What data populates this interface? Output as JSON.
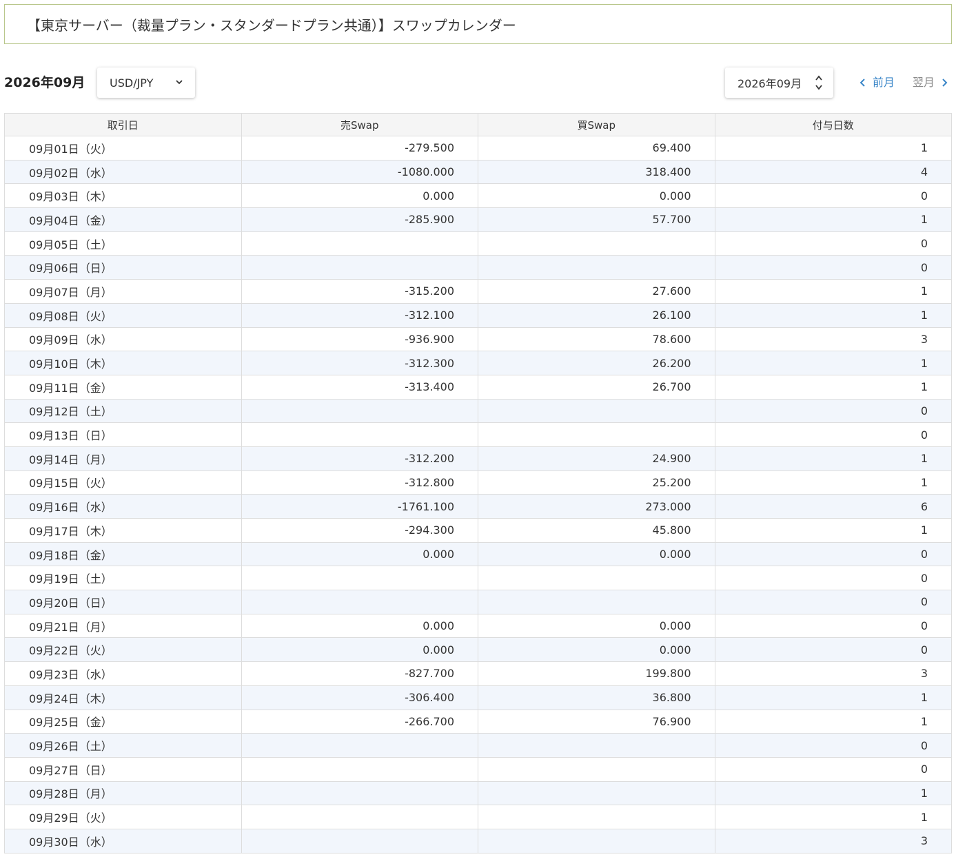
{
  "title": "【東京サーバー（裁量プラン・スタンダードプラン共通）】スワップカレンダー",
  "toolbar": {
    "month_label": "2026年09月",
    "pair_value": "USD/JPY",
    "month_input_value": "2026年09月",
    "prev_label": "前月",
    "next_label": "翌月"
  },
  "table": {
    "headers": [
      "取引日",
      "売Swap",
      "買Swap",
      "付与日数"
    ],
    "rows": [
      {
        "date": "09月01日（火）",
        "sell": "-279.500",
        "buy": "69.400",
        "days": "1"
      },
      {
        "date": "09月02日（水）",
        "sell": "-1080.000",
        "buy": "318.400",
        "days": "4"
      },
      {
        "date": "09月03日（木）",
        "sell": "0.000",
        "buy": "0.000",
        "days": "0"
      },
      {
        "date": "09月04日（金）",
        "sell": "-285.900",
        "buy": "57.700",
        "days": "1"
      },
      {
        "date": "09月05日（土）",
        "sell": "",
        "buy": "",
        "days": "0"
      },
      {
        "date": "09月06日（日）",
        "sell": "",
        "buy": "",
        "days": "0"
      },
      {
        "date": "09月07日（月）",
        "sell": "-315.200",
        "buy": "27.600",
        "days": "1"
      },
      {
        "date": "09月08日（火）",
        "sell": "-312.100",
        "buy": "26.100",
        "days": "1"
      },
      {
        "date": "09月09日（水）",
        "sell": "-936.900",
        "buy": "78.600",
        "days": "3"
      },
      {
        "date": "09月10日（木）",
        "sell": "-312.300",
        "buy": "26.200",
        "days": "1"
      },
      {
        "date": "09月11日（金）",
        "sell": "-313.400",
        "buy": "26.700",
        "days": "1"
      },
      {
        "date": "09月12日（土）",
        "sell": "",
        "buy": "",
        "days": "0"
      },
      {
        "date": "09月13日（日）",
        "sell": "",
        "buy": "",
        "days": "0"
      },
      {
        "date": "09月14日（月）",
        "sell": "-312.200",
        "buy": "24.900",
        "days": "1"
      },
      {
        "date": "09月15日（火）",
        "sell": "-312.800",
        "buy": "25.200",
        "days": "1"
      },
      {
        "date": "09月16日（水）",
        "sell": "-1761.100",
        "buy": "273.000",
        "days": "6"
      },
      {
        "date": "09月17日（木）",
        "sell": "-294.300",
        "buy": "45.800",
        "days": "1"
      },
      {
        "date": "09月18日（金）",
        "sell": "0.000",
        "buy": "0.000",
        "days": "0"
      },
      {
        "date": "09月19日（土）",
        "sell": "",
        "buy": "",
        "days": "0"
      },
      {
        "date": "09月20日（日）",
        "sell": "",
        "buy": "",
        "days": "0"
      },
      {
        "date": "09月21日（月）",
        "sell": "0.000",
        "buy": "0.000",
        "days": "0"
      },
      {
        "date": "09月22日（火）",
        "sell": "0.000",
        "buy": "0.000",
        "days": "0"
      },
      {
        "date": "09月23日（水）",
        "sell": "-827.700",
        "buy": "199.800",
        "days": "3"
      },
      {
        "date": "09月24日（木）",
        "sell": "-306.400",
        "buy": "36.800",
        "days": "1"
      },
      {
        "date": "09月25日（金）",
        "sell": "-266.700",
        "buy": "76.900",
        "days": "1"
      },
      {
        "date": "09月26日（土）",
        "sell": "",
        "buy": "",
        "days": "0"
      },
      {
        "date": "09月27日（日）",
        "sell": "",
        "buy": "",
        "days": "0"
      },
      {
        "date": "09月28日（月）",
        "sell": "",
        "buy": "",
        "days": "1"
      },
      {
        "date": "09月29日（火）",
        "sell": "",
        "buy": "",
        "days": "1"
      },
      {
        "date": "09月30日（水）",
        "sell": "",
        "buy": "",
        "days": "3"
      }
    ]
  },
  "colors": {
    "title_border": "#b9c78c",
    "link_active": "#3a86c8",
    "link_inactive": "#8a8a8a",
    "row_stripe": "#f2f6fc",
    "header_bg": "#f5f5f5"
  },
  "icons": {
    "pair_select": "chevron-down-icon",
    "month_spinner": "up-down-spinner-icon",
    "prev": "chevron-left-icon",
    "next": "chevron-right-icon"
  }
}
